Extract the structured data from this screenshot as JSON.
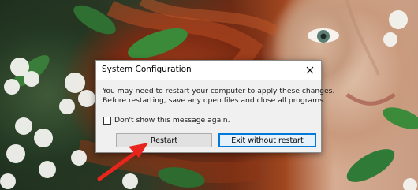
{
  "dialog": {
    "title": "System Configuration",
    "message_line1": "You may need to restart your computer to apply these changes.",
    "message_line2": "Before restarting, save any open files and close all programs.",
    "checkbox_label": "Don't show this message again.",
    "checkbox_checked": false,
    "restart_label": "Restart",
    "exit_label": "Exit without restart"
  },
  "annotation": {
    "arrow_color": "#e8251c",
    "points_to": "restart-button"
  },
  "icons": [
    "close-icon",
    "annotation-arrow-icon"
  ]
}
